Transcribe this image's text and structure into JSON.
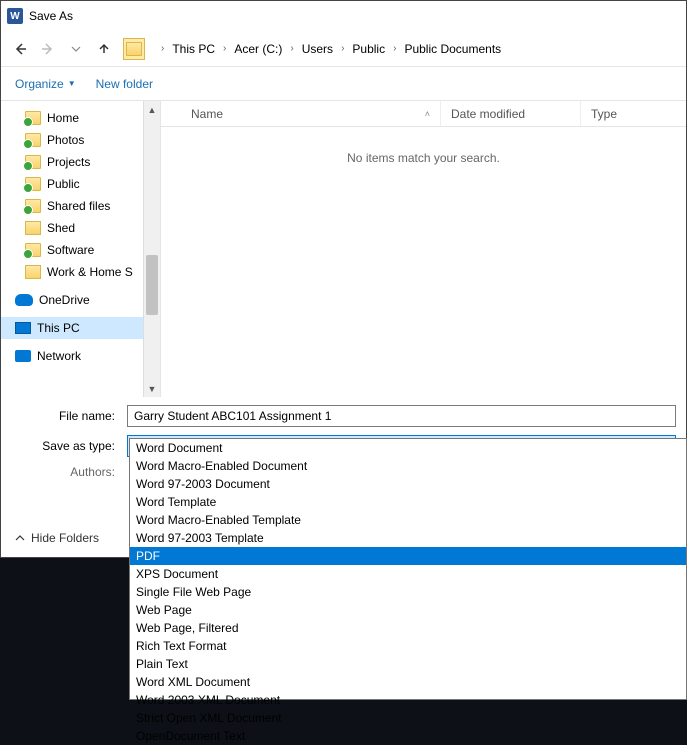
{
  "title": "Save As",
  "breadcrumbs": [
    "This PC",
    "Acer (C:)",
    "Users",
    "Public",
    "Public Documents"
  ],
  "toolbar": {
    "organize": "Organize",
    "newfolder": "New folder"
  },
  "columns": {
    "name": "Name",
    "date": "Date modified",
    "type": "Type"
  },
  "empty_message": "No items match your search.",
  "tree": {
    "items": [
      {
        "label": "Home",
        "icon": "folder-sync"
      },
      {
        "label": "Photos",
        "icon": "folder-sync"
      },
      {
        "label": "Projects",
        "icon": "folder-sync"
      },
      {
        "label": "Public",
        "icon": "folder-sync"
      },
      {
        "label": "Shared files",
        "icon": "folder-sync"
      },
      {
        "label": "Shed",
        "icon": "people"
      },
      {
        "label": "Software",
        "icon": "folder-sync"
      },
      {
        "label": "Work & Home S",
        "icon": "people"
      }
    ],
    "onedrive": "OneDrive",
    "thispc": "This PC",
    "network": "Network"
  },
  "fields": {
    "filename_label": "File name:",
    "filename_value": "Garry Student ABC101 Assignment 1",
    "type_label": "Save as type:",
    "type_value": "Word Document",
    "authors_label": "Authors:"
  },
  "hide_folders": "Hide Folders",
  "type_options": [
    "Word Document",
    "Word Macro-Enabled Document",
    "Word 97-2003 Document",
    "Word Template",
    "Word Macro-Enabled Template",
    "Word 97-2003 Template",
    "PDF",
    "XPS Document",
    "Single File Web Page",
    "Web Page",
    "Web Page, Filtered",
    "Rich Text Format",
    "Plain Text",
    "Word XML Document",
    "Word 2003 XML Document",
    "Strict Open XML Document",
    "OpenDocument Text"
  ],
  "highlighted_option_index": 6
}
